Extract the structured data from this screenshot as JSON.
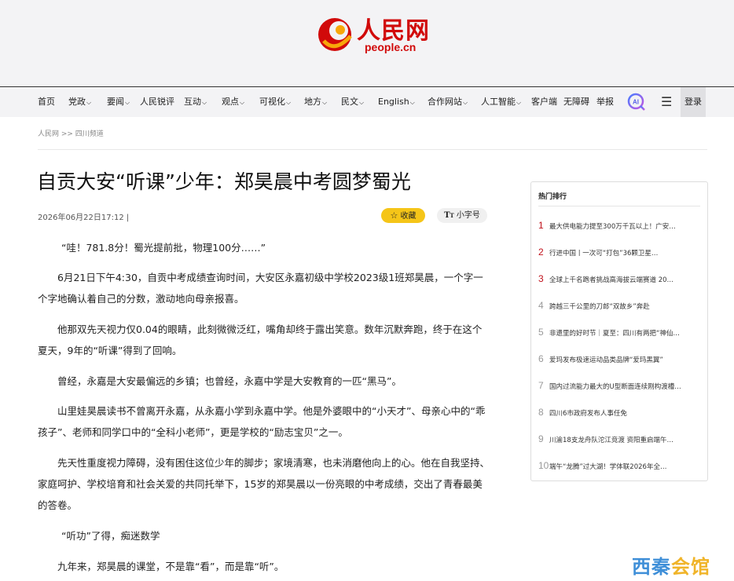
{
  "logo": {
    "cn": "人民网",
    "en": "people.cn"
  },
  "nav": {
    "items": [
      {
        "label": "首页",
        "chev": false
      },
      {
        "label": "党政",
        "chev": true
      },
      {
        "label": "要闻",
        "chev": true
      },
      {
        "label": "人民锐评",
        "chev": false
      },
      {
        "label": "互动",
        "chev": true
      },
      {
        "label": "观点",
        "chev": true
      },
      {
        "label": "可视化",
        "chev": true
      },
      {
        "label": "地方",
        "chev": true
      },
      {
        "label": "民文",
        "chev": true
      },
      {
        "label": "English",
        "chev": true
      },
      {
        "label": "合作网站",
        "chev": true
      },
      {
        "label": "人工智能",
        "chev": true
      },
      {
        "label": "客户端",
        "chev": false
      },
      {
        "label": "无障碍",
        "chev": false
      },
      {
        "label": "举报",
        "chev": false
      }
    ],
    "ai_label": "AI",
    "login": "登录"
  },
  "breadcrumb": "人民网 >> 四川频道",
  "article": {
    "title": "自贡大安“听课”少年：郑昊晨中考圆梦蜀光",
    "meta": "2026年06月22日17:12 |",
    "fav_label": "收藏",
    "font_label": "小字号",
    "paragraphs": [
      "“哇！781.8分！蜀光提前批，物理100分……”",
      "6月21日下午4:30，自贡中考成绩查询时间，大安区永嘉初级中学校2023级1班郑昊晨，一个字一个字地确认着自己的分数，激动地向母亲报喜。",
      "他那双先天视力仅0.04的眼睛，此刻微微泛红，嘴角却终于露出笑意。数年沉默奔跑，终于在这个夏天，9年的“听课”得到了回响。",
      "曾经，永嘉是大安最偏远的乡镇；也曾经，永嘉中学是大安教育的一匹“黑马”。",
      "山里娃昊晨读书不曾离开永嘉，从永嘉小学到永嘉中学。他是外婆眼中的“小天才”、母亲心中的“乖孩子”、老师和同学口中的“全科小老师”，更是学校的“励志宝贝”之一。",
      "先天性重度视力障碍，没有困住这位少年的脚步；家境清寒，也未消磨他向上的心。他在自我坚持、家庭呵护、学校培育和社会关爱的共同托举下，15岁的郑昊晨以一份亮眼的中考成绩，交出了青春最美的答卷。",
      "“听功”了得，痴迷数学",
      "九年来，郑昊晨的课堂，不是靠“看”，而是靠“听”。"
    ]
  },
  "hot": {
    "title": "热门排行",
    "items": [
      {
        "num": "1",
        "text": "最大供电能力提至300万千瓦以上！广安…",
        "red": true
      },
      {
        "num": "2",
        "text": "行进中国 | 一次可“打包”36颗卫星…",
        "red": true
      },
      {
        "num": "3",
        "text": "全球上千名跑者挑战高海拔云端赛道 20…",
        "red": true
      },
      {
        "num": "4",
        "text": "跨越三千公里的刀郎“双故乡”奔赴",
        "red": false
      },
      {
        "num": "5",
        "text": "非遗里的好时节｜夏至：四川有两把“神仙…",
        "red": false
      },
      {
        "num": "6",
        "text": "爱玛发布极速运动品类品牌“爱玛黑翼”",
        "red": false
      },
      {
        "num": "7",
        "text": "国内过流能力最大的U型断面连续刚构渡槽…",
        "red": false
      },
      {
        "num": "8",
        "text": "四川6市政府发布人事任免",
        "red": false
      },
      {
        "num": "9",
        "text": "川渝18支龙舟队沱江竞渡 资阳重启端午…",
        "red": false
      },
      {
        "num": "10",
        "text": "端午“龙腾”过大湖！学体联2026年全…",
        "red": false
      }
    ]
  },
  "watermark": {
    "a": "西秦",
    "b": "会馆"
  },
  "colors": {
    "brand_red": "#d10a0a",
    "fav_yellow": "#f5c518",
    "rank_red": "#c0101a"
  }
}
